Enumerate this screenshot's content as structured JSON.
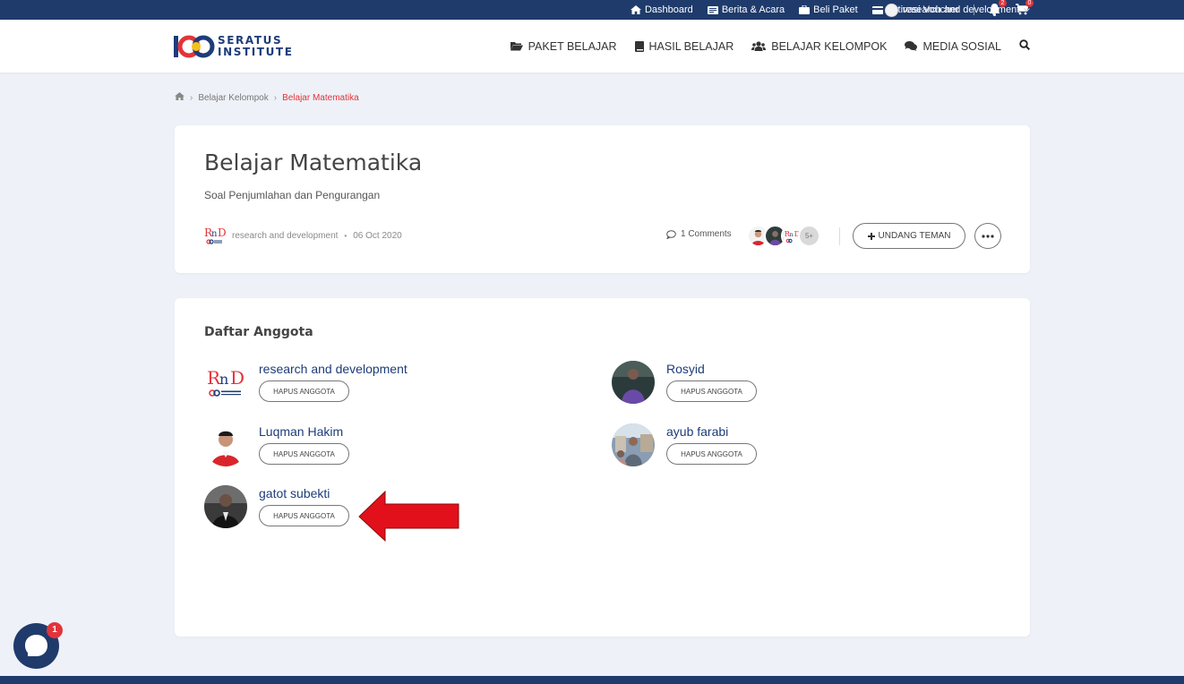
{
  "topbar": {
    "items": [
      {
        "label": "Dashboard",
        "icon": "home-icon"
      },
      {
        "label": "Berita & Acara",
        "icon": "newspaper-icon"
      },
      {
        "label": "Beli Paket",
        "icon": "briefcase-icon"
      },
      {
        "label": "Aktivasi Voucher",
        "icon": "card-icon"
      }
    ],
    "notif_count": "2",
    "cart_count": "0",
    "user_name": "research and development"
  },
  "header": {
    "logo_line1": "SERATUS",
    "logo_line2": "INSTITUTE",
    "nav": [
      {
        "label": "PAKET BELAJAR",
        "icon": "folder-icon"
      },
      {
        "label": "HASIL BELAJAR",
        "icon": "book-icon"
      },
      {
        "label": "BELAJAR KELOMPOK",
        "icon": "users-icon"
      },
      {
        "label": "MEDIA SOSIAL",
        "icon": "comments-icon"
      }
    ]
  },
  "breadcrumb": {
    "sep": "›",
    "parent": "Belajar Kelompok",
    "current": "Belajar Matematika"
  },
  "group": {
    "title": "Belajar Matematika",
    "description": "Soal Penjumlahan dan Pengurangan",
    "owner": "research and development",
    "dot": "•",
    "date": "06 Oct 2020",
    "comments": "1 Comments",
    "more_members": "5+",
    "invite_label": "UNDANG TEMAN"
  },
  "members": {
    "title": "Daftar Anggota",
    "remove_label": "HAPUS ANGGOTA",
    "list": [
      {
        "name": "research and development"
      },
      {
        "name": "Rosyid"
      },
      {
        "name": "Luqman Hakim"
      },
      {
        "name": "ayub farabi"
      },
      {
        "name": "gatot subekti"
      }
    ]
  },
  "chat": {
    "badge": "1"
  },
  "colors": {
    "navy": "#1f3b6b",
    "accent_red": "#e2343a",
    "link_blue": "#1d3c7a"
  }
}
